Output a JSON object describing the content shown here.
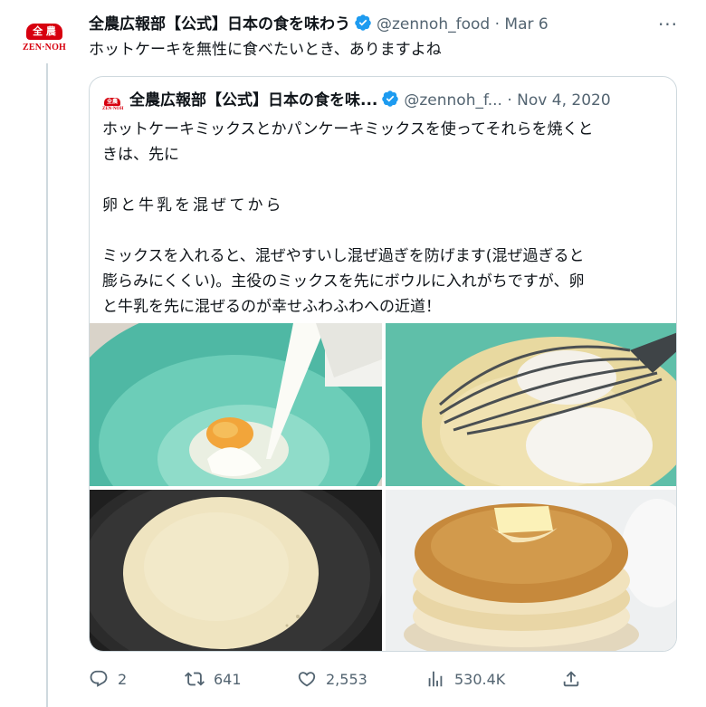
{
  "tweet": {
    "author_name": "全農広報部【公式】日本の食を味わう",
    "handle": "@zennoh_food",
    "separator": "·",
    "date": "Mar 6",
    "more_label": "···",
    "text": "ホットケーキを無性に食べたいとき、ありますよね",
    "logo": {
      "kanji": "全 農",
      "text": "ZEN·NOH"
    }
  },
  "quote": {
    "author_name": "全農広報部【公式】日本の食を味...",
    "handle": "@zennoh_f...",
    "separator": "·",
    "date": "Nov 4, 2020",
    "logo_kanji": "全農",
    "logo_text": "ZEN·NOH",
    "lines": {
      "l1": "ホットケーキミックスとかパンケーキミックスを使ってそれらを焼くと",
      "l2": "きは、先に",
      "l3": "卵と牛乳を混ぜてから",
      "l4": "ミックスを入れると、混ぜやすいし混ぜ過ぎを防げます(混ぜ過ぎると",
      "l5": "膨らみにくくい)。主役のミックスを先にボウルに入れがちですが、卵",
      "l6": "と牛乳を先に混ぜるのが幸せふわふわへの近道！"
    }
  },
  "actions": {
    "replies": "2",
    "retweets": "641",
    "likes": "2,553",
    "views": "530.4K"
  },
  "colors": {
    "text_primary": "#0f1419",
    "text_secondary": "#536471",
    "verified": "#1d9bf0",
    "brand_red": "#d7000f",
    "border": "#cfd9de"
  },
  "icons": [
    "verified-badge-icon",
    "more-icon",
    "reply-icon",
    "retweet-icon",
    "like-icon",
    "views-icon",
    "share-icon"
  ]
}
